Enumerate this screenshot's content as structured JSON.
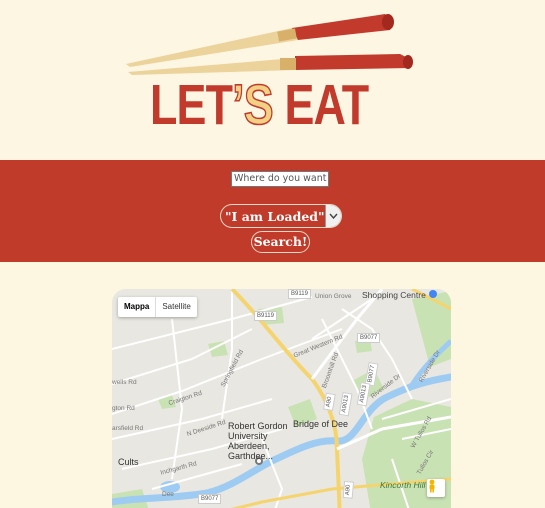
{
  "logo": {
    "text_a": "LET",
    "text_b": "’S",
    "text_c": " EAT"
  },
  "search": {
    "placeholder": "Where do you want to",
    "value": ""
  },
  "budget_select": {
    "selected": "\"I am Loaded\""
  },
  "search_button": {
    "label": "Search!"
  },
  "map": {
    "type_controls": {
      "map": "Mappa",
      "satellite": "Satellite"
    },
    "places": {
      "rgu_line1": "Robert Gordon",
      "rgu_line2": "University",
      "rgu_line3": "Aberdeen,",
      "rgu_line4": "Garthdee...",
      "bridge_of_dee": "Bridge of Dee",
      "cults": "Cults",
      "kincorth": "Kincorth Hill",
      "shopping": "Shopping Centre"
    },
    "streets": {
      "union_grove": "Union Grove",
      "great_western": "Great Western Rd",
      "springfield": "Springfield Rd",
      "craigton": "Craigton Rd",
      "n_deeside": "N Deeside Rd",
      "inchgarth": "Inchgarth Rd",
      "broomhill": "Broomhill Rd",
      "riverside": "Riverside Dr",
      "riverside2": "Riverside Dr",
      "wells": "wells Rd",
      "ton_rd": "gton Rd",
      "arsfield": "arsfield Rd",
      "wtullos": "W Tullos Rd",
      "tullos": "Tullos Cir"
    },
    "road_numbers": {
      "b9119": "B9119",
      "b9119b": "B9119",
      "a90": "A90",
      "a90b": "A90",
      "a9013": "A9013",
      "b9077": "B9077",
      "b9077b": "B9077",
      "a9013b": "A9013",
      "b9077c": "B9077",
      "dee": "Dee"
    }
  }
}
